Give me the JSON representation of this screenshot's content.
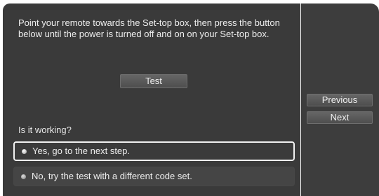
{
  "instruction": "Point your remote towards the Set-top box, then press the button below until the power is turned off and on on your Set-top box.",
  "test_button": "Test",
  "question": "Is it working?",
  "options": [
    {
      "label": "Yes, go to the next step.",
      "selected": true
    },
    {
      "label": "No, try the test with a different code set.",
      "selected": false
    }
  ],
  "nav": {
    "previous": "Previous",
    "next": "Next"
  }
}
